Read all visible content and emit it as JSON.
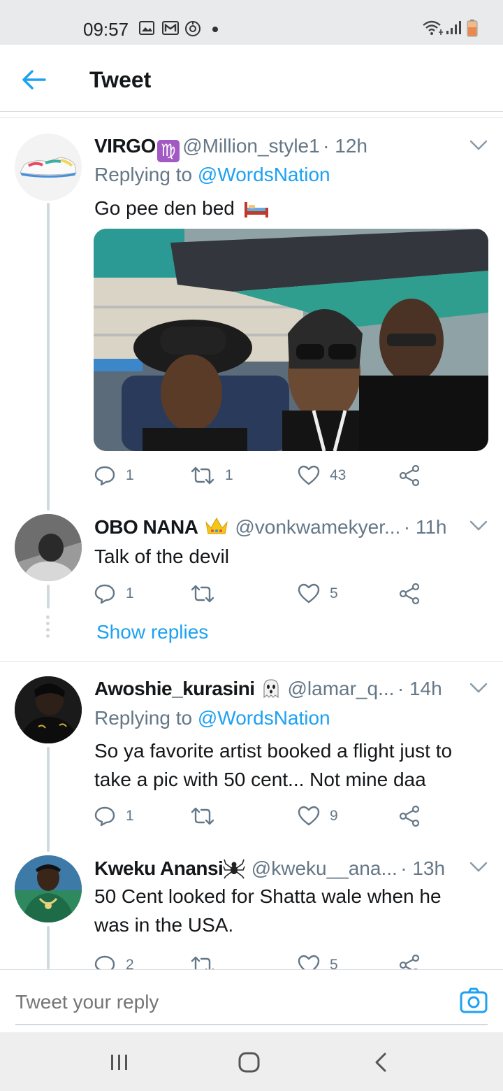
{
  "status_bar": {
    "time": "09:57",
    "left_icons": [
      "gallery-icon",
      "mail-icon",
      "vpn-icon",
      "dot-icon"
    ],
    "right_icons": [
      "wifi-icon",
      "signal-icon",
      "battery-icon"
    ]
  },
  "header": {
    "title": "Tweet"
  },
  "tweets": [
    {
      "name": "VIRGO",
      "badge": "♍",
      "handle": "@Million_style1",
      "time": "· 12h",
      "replying_prefix": "Replying to ",
      "replying_to": "@WordsNation",
      "text": "Go pee den bed",
      "text_emoji": "bed-emoji",
      "replies": "1",
      "retweets": "1",
      "likes": "43"
    },
    {
      "name": "OBO NANA",
      "badge": "👑",
      "handle": "@vonkwamekyer...",
      "time": "· 11h",
      "text": "Talk of the devil",
      "replies": "1",
      "retweets": "",
      "likes": "5",
      "show_replies": "Show replies"
    },
    {
      "name": "Awoshie_kurasini",
      "badge": "👻",
      "handle": "@lamar_q...",
      "time": "· 14h",
      "replying_prefix": "Replying to ",
      "replying_to": "@WordsNation",
      "text_line1": "So ya favorite artist booked a flight just to",
      "text_line2": "take a pic with 50 cent... Not mine daa",
      "replies": "1",
      "retweets": "",
      "likes": "9"
    },
    {
      "name": "Kweku Anansi",
      "badge": "🕷",
      "handle": "@kweku__ana...",
      "time": "· 13h",
      "text_line1": "50 Cent looked for Shatta wale when he",
      "text_line2": "was in the USA.",
      "replies": "2",
      "retweets": "",
      "likes": "5"
    }
  ],
  "composer": {
    "placeholder": "Tweet your reply"
  },
  "colors": {
    "accent": "#1da1f2",
    "secondary_text": "#657786",
    "primary_text": "#14171a",
    "virgo_badge": "#a259c4"
  }
}
